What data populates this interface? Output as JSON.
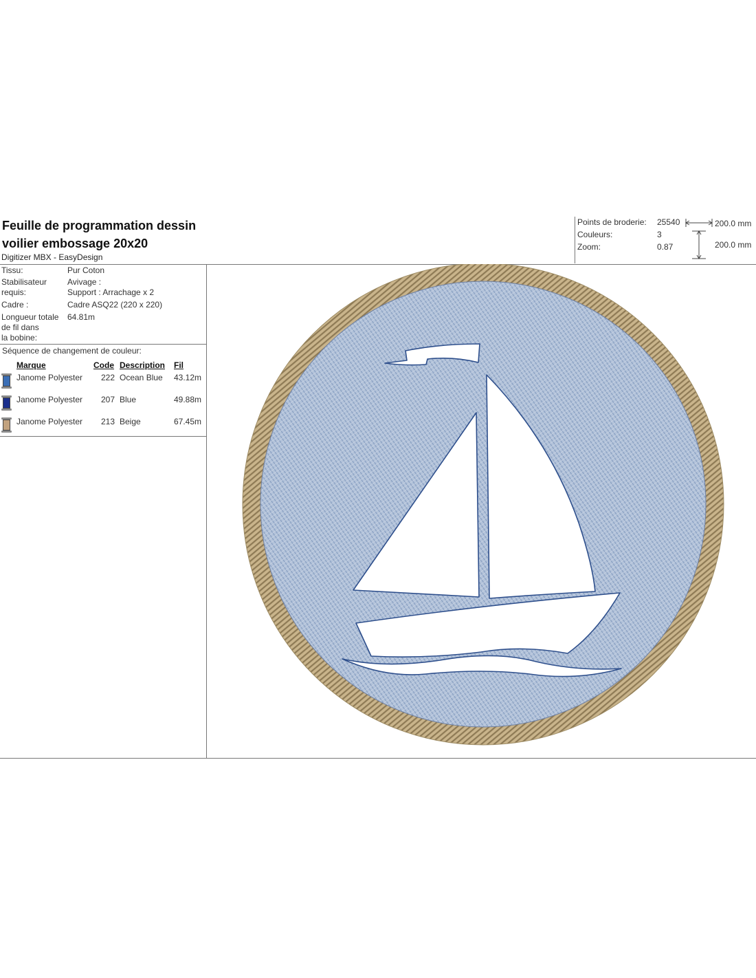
{
  "header": {
    "title_line1": "Feuille de programmation dessin",
    "title_line2": "voilier embossage 20x20",
    "software": "Digitizer MBX - EasyDesign"
  },
  "stats": {
    "stitches_label": "Points de broderie:",
    "stitches_value": "25540",
    "colors_label": "Couleurs:",
    "colors_value": "3",
    "zoom_label": "Zoom:",
    "zoom_value": "0.87",
    "width": "200.0 mm",
    "height": "200.0 mm"
  },
  "info": {
    "fabric_label": "Tissu:",
    "fabric_value": "Pur Coton",
    "stabilizer_label_1": "Stabilisateur",
    "stabilizer_label_2": "requis:",
    "stabilizer_value_1": "Avivage :",
    "stabilizer_value_2": "Support : Arrachage x 2",
    "hoop_label": "Cadre :",
    "hoop_value": "Cadre ASQ22 (220 x 220)",
    "bobbin_label_1": "Longueur totale",
    "bobbin_label_2": "de fil dans",
    "bobbin_label_3": "la bobine:",
    "bobbin_value": "64.81m"
  },
  "color_sequence": {
    "heading": "Séquence de changement de couleur:",
    "columns": {
      "brand": "Marque",
      "code": "Code",
      "description": "Description",
      "thread": "Fil"
    },
    "rows": [
      {
        "brand": "Janome Polyester",
        "code": "222",
        "description": "Ocean Blue",
        "thread": "43.12m",
        "color": "#3b6fb6"
      },
      {
        "brand": "Janome Polyester",
        "code": "207",
        "description": "Blue",
        "thread": "49.88m",
        "color": "#1b2f8c"
      },
      {
        "brand": "Janome Polyester",
        "code": "213",
        "description": "Beige",
        "thread": "67.45m",
        "color": "#c2a27e"
      }
    ]
  },
  "design": {
    "border_color": "#b8a57d",
    "fill_color": "#a7b9d2",
    "outline_color": "#2e4f8c"
  }
}
